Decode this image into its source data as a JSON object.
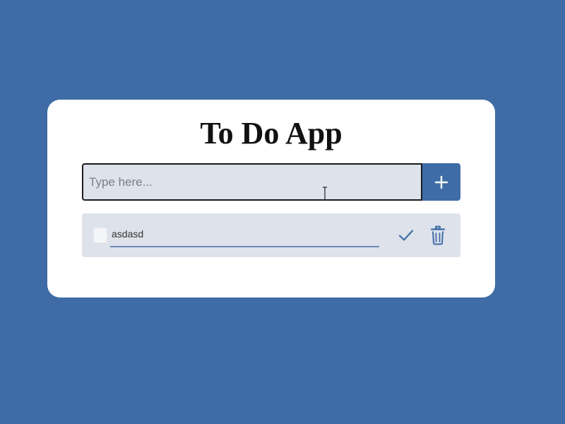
{
  "app": {
    "title": "To Do App"
  },
  "input": {
    "placeholder": "Type here...",
    "value": ""
  },
  "add_button": {
    "icon": "plus-icon"
  },
  "todos": [
    {
      "text": "asdasd",
      "checked": false,
      "complete_icon": "check-icon",
      "delete_icon": "trash-icon"
    }
  ],
  "colors": {
    "background": "#3f6ca6",
    "card": "#ffffff",
    "accent": "#3f6ca6",
    "input_bg": "#dde2eb",
    "item_bg": "#dde2eb"
  }
}
